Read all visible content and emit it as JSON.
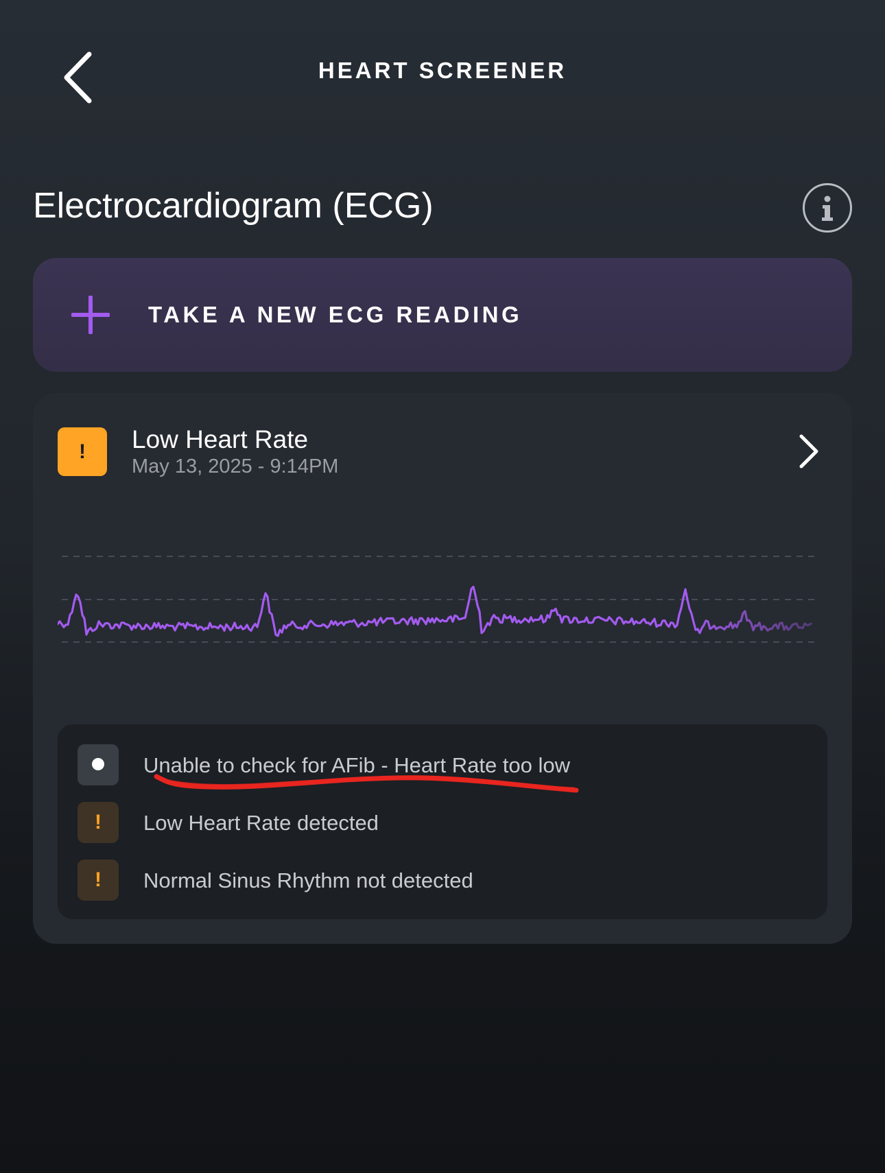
{
  "header": {
    "title": "HEART SCREENER",
    "back_icon": "chevron-left-icon"
  },
  "page": {
    "title": "Electrocardiogram (ECG)",
    "info_icon": "info-icon"
  },
  "take_reading": {
    "label": "TAKE A NEW ECG READING",
    "icon": "plus-icon",
    "accent": "#a35bf0"
  },
  "result": {
    "badge_symbol": "!",
    "badge_color": "#ffa424",
    "title": "Low Heart Rate",
    "date": "May 13, 2025 - 9:14PM",
    "ecg_color": "#a35bf0"
  },
  "findings": [
    {
      "icon": "dot-icon",
      "text": "Unable to check for AFib - Heart Rate too low"
    },
    {
      "icon": "warning-icon",
      "symbol": "!",
      "text": "Low Heart Rate detected"
    },
    {
      "icon": "warning-icon",
      "symbol": "!",
      "text": "Normal Sinus Rhythm not detected"
    }
  ],
  "annotation": {
    "type": "hand-drawn underline",
    "color": "#e8261f"
  }
}
